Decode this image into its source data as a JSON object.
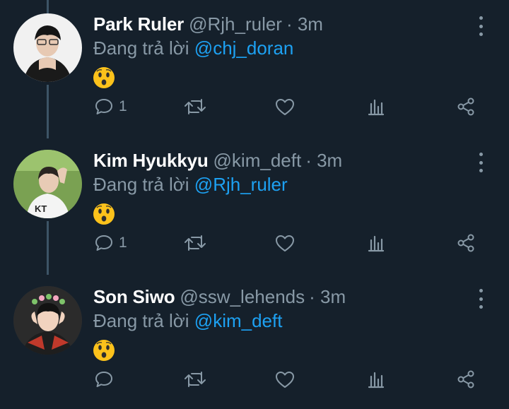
{
  "thread": {
    "reply_prefix": "Đang trả lời",
    "tweets": [
      {
        "name": "Park Ruler",
        "handle": "@Rjh_ruler",
        "time": "· 3m",
        "reply_to": "@chj_doran",
        "emoji": "hushed-face-emoji",
        "reply_count": "1"
      },
      {
        "name": "Kim Hyukkyu",
        "handle": "@kim_deft",
        "time": "· 3m",
        "reply_to": "@Rjh_ruler",
        "emoji": "hushed-face-emoji",
        "reply_count": "1"
      },
      {
        "name": "Son Siwo",
        "handle": "@ssw_lehends",
        "time": "· 3m",
        "reply_to": "@kim_deft",
        "emoji": "hushed-face-emoji",
        "reply_count": ""
      }
    ]
  },
  "icons": {
    "reply": "speech-bubble-icon",
    "retweet": "retweet-icon",
    "like": "heart-icon",
    "analytics": "bar-chart-icon",
    "share": "share-icon",
    "more": "vertical-dots-icon"
  },
  "colors": {
    "background": "#15202b",
    "name": "#ffffff",
    "secondary": "#8899a6",
    "mention": "#1da1f2",
    "thread_line": "#3d5466"
  }
}
